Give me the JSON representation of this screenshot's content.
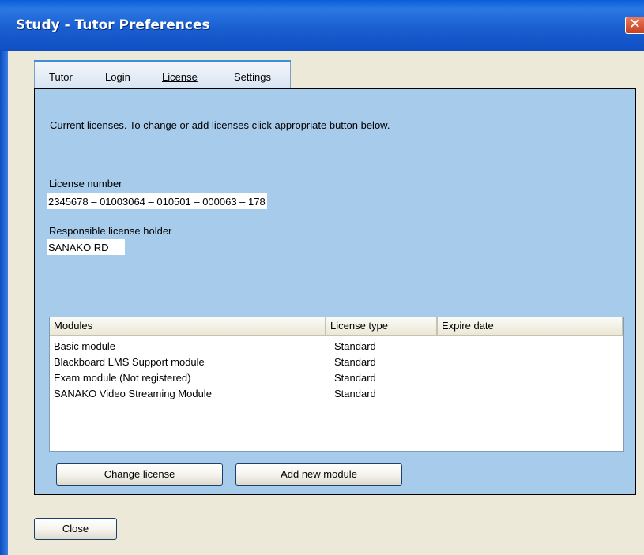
{
  "window": {
    "title": "Study - Tutor Preferences",
    "close_glyph": "✕"
  },
  "tabs": [
    {
      "label": "Tutor"
    },
    {
      "label": "Login"
    },
    {
      "label": "License",
      "active": true
    },
    {
      "label": "Settings"
    }
  ],
  "panel": {
    "description": "Current licenses. To change or add licenses click appropriate button below.",
    "license_number_label": "License number",
    "license_number": "2345678 – 01003064 – 010501 – 000063 – 178",
    "holder_label": "Responsible license holder",
    "holder": "SANAKO RD"
  },
  "modules_table": {
    "columns": [
      "Modules",
      "License type",
      "Expire date"
    ],
    "rows": [
      {
        "module": "Basic module",
        "license_type": "Standard",
        "expire_date": ""
      },
      {
        "module": "Blackboard LMS Support module",
        "license_type": "Standard",
        "expire_date": ""
      },
      {
        "module": "Exam module (Not registered)",
        "license_type": "Standard",
        "expire_date": ""
      },
      {
        "module": "SANAKO Video Streaming Module",
        "license_type": "Standard",
        "expire_date": ""
      }
    ]
  },
  "buttons": {
    "change_license": "Change license",
    "add_new_module": "Add new module",
    "close": "Close"
  },
  "colors": {
    "titlebar": "#1a5fd0",
    "panel_background": "#a7cbeb",
    "window_background": "#ece9d8",
    "close_button": "#c6401f"
  },
  "icons": {
    "close": "close-icon"
  }
}
